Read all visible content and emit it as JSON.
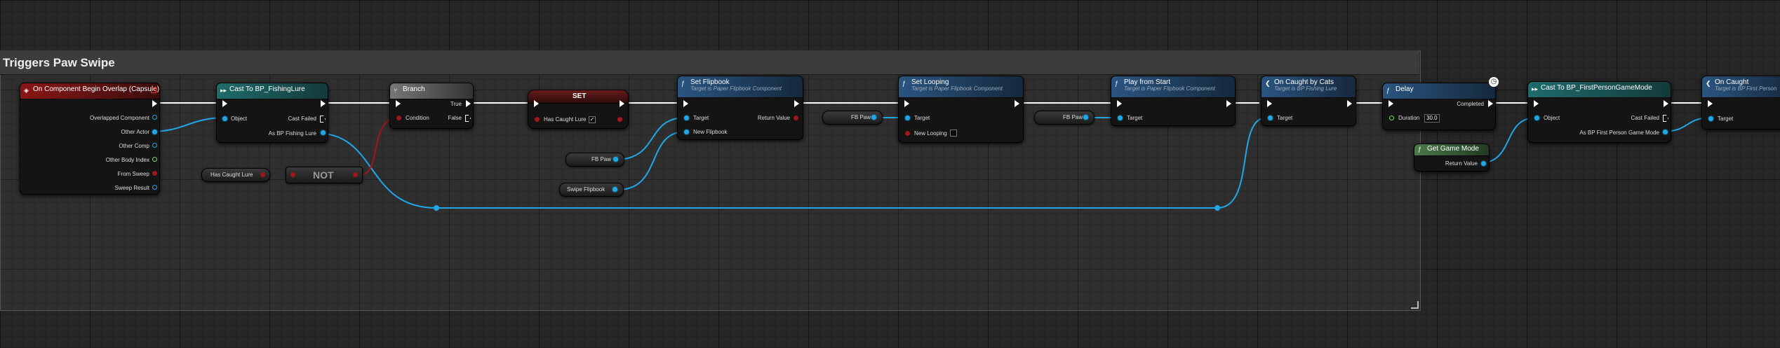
{
  "comment": {
    "title": "Triggers Paw Swipe"
  },
  "nodes": {
    "overlap": {
      "title": "On Component Begin Overlap (Capsule)",
      "pins": [
        "Overlapped Component",
        "Other Actor",
        "Other Comp",
        "Other Body Index",
        "From Sweep",
        "Sweep Result"
      ]
    },
    "cast_lure": {
      "title": "Cast To BP_FishingLure",
      "object": "Object",
      "cast_failed": "Cast Failed",
      "as": "As BP Fishing Lure"
    },
    "branch": {
      "title": "Branch",
      "condition": "Condition",
      "true": "True",
      "false": "False"
    },
    "set": {
      "title": "SET",
      "var": "Has Caught Lure"
    },
    "get_caught": {
      "label": "Has Caught Lure"
    },
    "not": {
      "label": "NOT"
    },
    "set_flipbook": {
      "title": "Set Flipbook",
      "subtitle": "Target is Paper Flipbook Component",
      "target": "Target",
      "new_flipbook": "New Flipbook",
      "return_value": "Return Value"
    },
    "fb_paw_1": {
      "label": "FB Paw"
    },
    "swipe_flipbook": {
      "label": "Swipe Flipbook"
    },
    "set_looping": {
      "title": "Set Looping",
      "subtitle": "Target is Paper Flipbook Component",
      "target": "Target",
      "new_looping": "New Looping"
    },
    "fb_paw_2": {
      "label": "FB Paw"
    },
    "fb_paw_3": {
      "label": "FB Paw"
    },
    "play_from_start": {
      "title": "Play from Start",
      "subtitle": "Target is Paper Flipbook Component",
      "target": "Target"
    },
    "caught_by_cats": {
      "title": "On Caught by Cats",
      "subtitle": "Target is BP Fishing Lure",
      "target": "Target"
    },
    "delay": {
      "title": "Delay",
      "duration": "Duration",
      "duration_value": "30.0",
      "completed": "Completed"
    },
    "get_game_mode": {
      "title": "Get Game Mode",
      "return_value": "Return Value"
    },
    "cast_fpgm": {
      "title": "Cast To BP_FirstPersonGameMode",
      "object": "Object",
      "cast_failed": "Cast Failed",
      "as": "As BP First Person Game Mode"
    },
    "on_caught": {
      "title": "On Caught",
      "subtitle": "Target is BP First Person",
      "target": "Target"
    }
  },
  "colors": {
    "event_header": "#7a1414",
    "cast_header": "#1f5c5c",
    "func_header": "#2a4d70",
    "branch_header": "#555555",
    "set_header": "#5a1a1a",
    "pure_header": "#3d6b3d",
    "exec_wire": "#ffffff",
    "object_wire": "#1fa8e8",
    "bool_wire": "#a0161a"
  }
}
